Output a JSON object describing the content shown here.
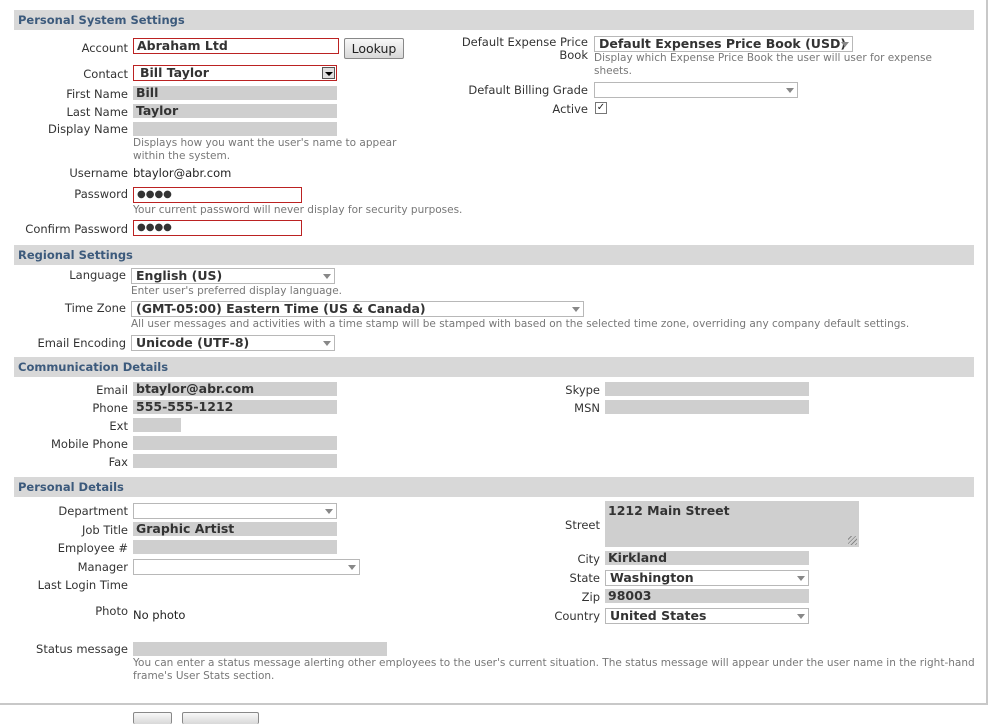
{
  "sections": {
    "personal_system": "Personal System Settings",
    "regional": "Regional Settings",
    "communication": "Communication Details",
    "personal_details": "Personal Details"
  },
  "system": {
    "account_label": "Account",
    "account_value": "Abraham Ltd",
    "lookup_button": "Lookup",
    "contact_label": "Contact",
    "contact_value": "Bill Taylor",
    "first_name_label": "First Name",
    "first_name_value": "Bill",
    "last_name_label": "Last Name",
    "last_name_value": "Taylor",
    "display_name_label": "Display Name",
    "display_name_value": "",
    "display_name_hint": "Displays how you want the user's name to appear within the system.",
    "username_label": "Username",
    "username_value": "btaylor@abr.com",
    "password_label": "Password",
    "password_value": "●●●●",
    "password_hint": "Your current password will never display for security purposes.",
    "confirm_password_label": "Confirm Password",
    "confirm_password_value": "●●●●",
    "expense_price_book_label": "Default Expense Price Book",
    "expense_price_book_value": "Default Expenses Price Book (USD)",
    "expense_price_book_hint": "Display which Expense Price Book the user will user for expense sheets.",
    "billing_grade_label": "Default Billing Grade",
    "billing_grade_value": "",
    "active_label": "Active",
    "active_checked": "✓"
  },
  "regional": {
    "language_label": "Language",
    "language_value": "English (US)",
    "language_hint": "Enter user's preferred display language.",
    "timezone_label": "Time Zone",
    "timezone_value": "(GMT-05:00) Eastern Time (US & Canada)",
    "timezone_hint": "All user messages and activities with a time stamp will be stamped with based on the selected time zone, overriding any company default settings.",
    "encoding_label": "Email Encoding",
    "encoding_value": "Unicode (UTF-8)"
  },
  "communication": {
    "email_label": "Email",
    "email_value": "btaylor@abr.com",
    "phone_label": "Phone",
    "phone_value": "555-555-1212",
    "ext_label": "Ext",
    "ext_value": "",
    "mobile_label": "Mobile Phone",
    "mobile_value": "",
    "fax_label": "Fax",
    "fax_value": "",
    "skype_label": "Skype",
    "skype_value": "",
    "msn_label": "MSN",
    "msn_value": ""
  },
  "details": {
    "department_label": "Department",
    "department_value": "",
    "job_title_label": "Job Title",
    "job_title_value": "Graphic Artist",
    "employee_label": "Employee #",
    "employee_value": "",
    "manager_label": "Manager",
    "manager_value": "",
    "last_login_label": "Last Login Time",
    "last_login_value": "",
    "photo_label": "Photo",
    "photo_value": "No photo",
    "street_label": "Street",
    "street_value": "1212 Main Street",
    "city_label": "City",
    "city_value": "Kirkland",
    "state_label": "State",
    "state_value": "Washington",
    "zip_label": "Zip",
    "zip_value": "98003",
    "country_label": "Country",
    "country_value": "United States",
    "status_label": "Status message",
    "status_value": "",
    "status_hint": "You can enter a status message alerting other employees to the user's current situation. The status message will appear under the user name in the right-hand frame's User Stats section."
  }
}
